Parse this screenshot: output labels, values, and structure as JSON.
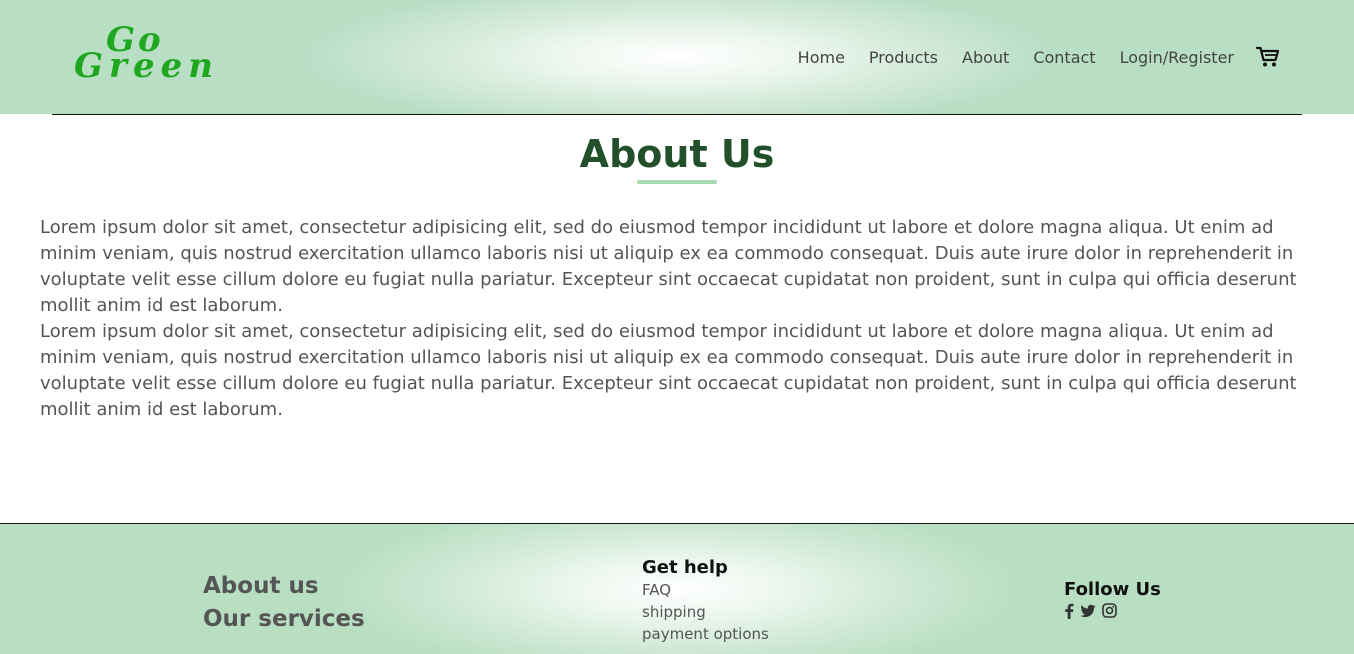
{
  "header": {
    "logo_line1": "Go",
    "logo_line2": "Green",
    "nav": [
      "Home",
      "Products",
      "About",
      "Contact",
      "Login/Register"
    ],
    "cart_icon": "cart-icon"
  },
  "main": {
    "title": "About Us",
    "paragraphs": [
      "Lorem ipsum dolor sit amet, consectetur adipisicing elit, sed do eiusmod tempor incididunt ut labore et dolore magna aliqua. Ut enim ad minim veniam, quis nostrud exercitation ullamco laboris nisi ut aliquip ex ea commodo consequat. Duis aute irure dolor in reprehenderit in voluptate velit esse cillum dolore eu fugiat nulla pariatur. Excepteur sint occaecat cupidatat non proident, sunt in culpa qui officia deserunt mollit anim id est laborum.",
      "Lorem ipsum dolor sit amet, consectetur adipisicing elit, sed do eiusmod tempor incididunt ut labore et dolore magna aliqua. Ut enim ad minim veniam, quis nostrud exercitation ullamco laboris nisi ut aliquip ex ea commodo consequat. Duis aute irure dolor in reprehenderit in voluptate velit esse cillum dolore eu fugiat nulla pariatur. Excepteur sint occaecat cupidatat non proident, sunt in culpa qui officia deserunt mollit anim id est laborum."
    ]
  },
  "footer": {
    "links_left": [
      "About us",
      "Our services"
    ],
    "help_heading": "Get help",
    "help_items": [
      "FAQ",
      "shipping",
      "payment options"
    ],
    "follow_heading": "Follow Us",
    "social_icons": [
      "facebook-icon",
      "twitter-icon",
      "instagram-icon"
    ]
  },
  "colors": {
    "brand_green": "#1fa81f",
    "title_green": "#22502a",
    "accent_underline": "#a7dbb4"
  }
}
